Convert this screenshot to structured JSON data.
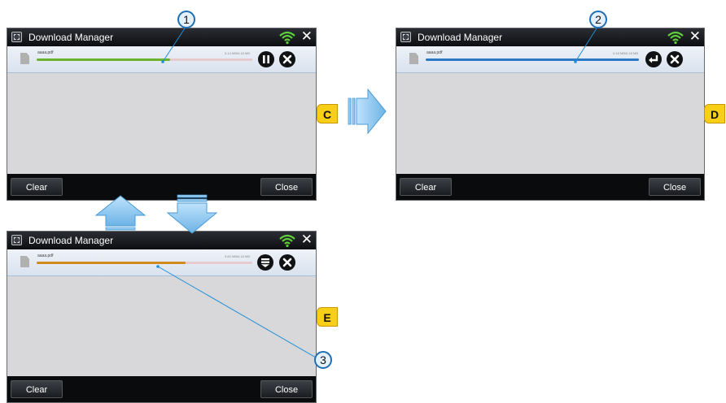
{
  "windows": [
    {
      "title": "Download Manager",
      "file_name": "aaaa.pdf",
      "file_size": "5.14 MB/6.18 MB",
      "progress": 0.62,
      "progress_color": "#6bb32c",
      "action_icon": "pause-icon",
      "cancel_icon": "cancel-icon",
      "clear_label": "Clear",
      "close_label": "Close",
      "close_x": "✕",
      "tag": "C",
      "callout": "1"
    },
    {
      "title": "Download Manager",
      "file_name": "aaaa.pdf",
      "file_size": "6.18 MB/6.18 MB",
      "progress": 1.0,
      "progress_color": "#2b78c4",
      "action_icon": "enter-icon",
      "cancel_icon": "cancel-icon",
      "clear_label": "Clear",
      "close_label": "Close",
      "close_x": "✕",
      "tag": "D",
      "callout": "2"
    },
    {
      "title": "Download Manager",
      "file_name": "aaaa.pdf",
      "file_size": "5.60 MB/6.18 MB",
      "progress": 0.69,
      "progress_color": "#d18a1b",
      "action_icon": "resume-download-icon",
      "cancel_icon": "cancel-icon",
      "clear_label": "Clear",
      "close_label": "Close",
      "close_x": "✕",
      "tag": "E",
      "callout": "3"
    }
  ],
  "colors": {
    "arrow_fill": "#7ec0ee",
    "callout_line": "#1f8fd6"
  }
}
